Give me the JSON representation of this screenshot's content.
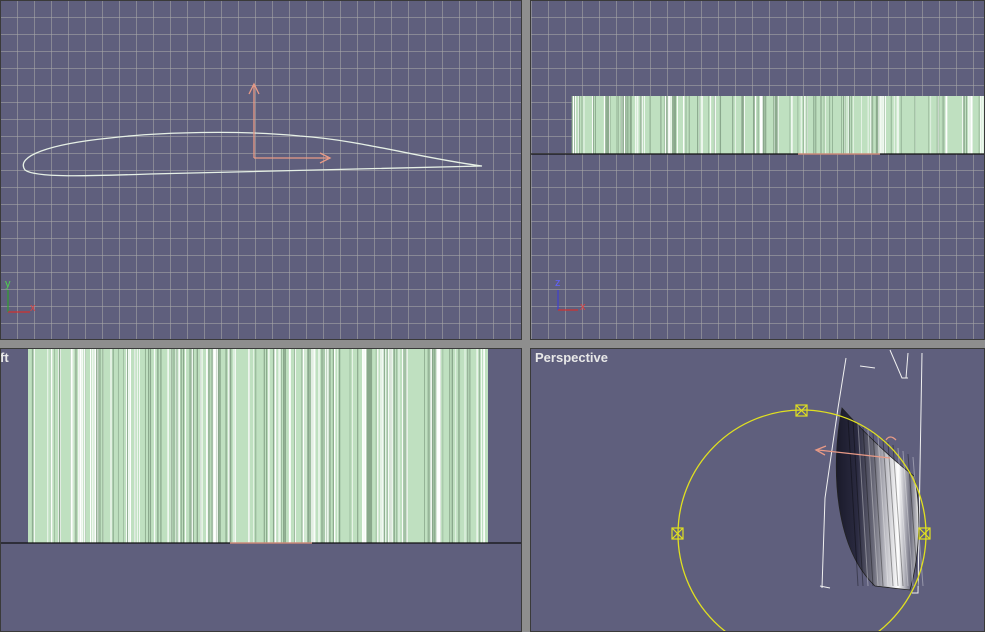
{
  "viewports": {
    "top": {
      "label": "",
      "axes": {
        "vertical": "y",
        "horizontal": "x"
      }
    },
    "front": {
      "label": "",
      "axes": {
        "vertical": "z",
        "horizontal": "x"
      }
    },
    "left": {
      "label": "ft"
    },
    "perspective": {
      "label": "Perspective"
    }
  },
  "colors": {
    "viewport_bg": "#5f5f7d",
    "grid": "#a0a0a8",
    "airfoil": "#e6f0e6",
    "mesh_fill": "#bfe0c0",
    "gizmo": "#e89a86",
    "rotate_gizmo": "#e0e020",
    "separator": "#8e8e8e"
  }
}
